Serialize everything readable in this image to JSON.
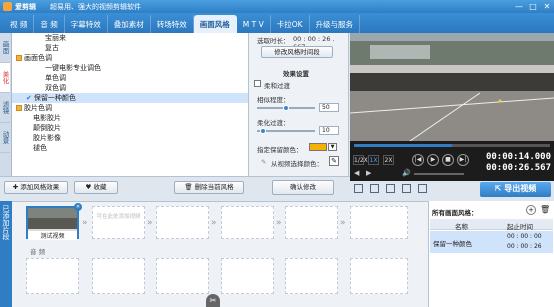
{
  "app": {
    "name": "爱剪辑",
    "slogan": "超易用、强大的视频剪辑软件"
  },
  "window": {
    "minimize": "—",
    "restore": "□",
    "close": "✕"
  },
  "tabs": [
    {
      "label": "视 频"
    },
    {
      "label": "音 频"
    },
    {
      "label": "字幕特效"
    },
    {
      "label": "叠加素材"
    },
    {
      "label": "转场特效"
    },
    {
      "label": "画面风格",
      "active": true
    },
    {
      "label": "M T V"
    },
    {
      "label": "卡拉OK"
    },
    {
      "label": "升级与服务"
    }
  ],
  "side_tabs": [
    {
      "label": "画面"
    },
    {
      "label": "美化",
      "active": true
    },
    {
      "label": "滤镜"
    },
    {
      "label": "动景"
    }
  ],
  "tree": [
    {
      "label": "宝丽来",
      "type": "deep"
    },
    {
      "label": "复古",
      "type": "deep"
    },
    {
      "label": "画面色调",
      "type": "group"
    },
    {
      "label": "一键电影专业调色",
      "type": "deep"
    },
    {
      "label": "单色调",
      "type": "deep"
    },
    {
      "label": "双色调",
      "type": "deep"
    },
    {
      "label": "保留一种颜色",
      "type": "deep",
      "selected": true
    },
    {
      "label": "胶片色调",
      "type": "group"
    },
    {
      "label": "电影胶片",
      "type": "child"
    },
    {
      "label": "颠倒胶片",
      "type": "child"
    },
    {
      "label": "胶片影像",
      "type": "child"
    },
    {
      "label": "褪色",
      "type": "child"
    }
  ],
  "settings": {
    "time_label": "选取时长：",
    "time_value": "00 : 00 : 26 . 667",
    "modify_time_button": "修改风格时间段",
    "section_title": "效果设置",
    "smooth_label": "柔和过渡",
    "similarity_label": "相似程度：",
    "similarity_value": "50",
    "similarity_level": 0.5,
    "softness_label": "柔化过渡：",
    "softness_value": "10",
    "softness_level": 0.1,
    "color_label": "指定保留颜色：",
    "pick_label": "从视频选择颜色："
  },
  "actions": {
    "add_style": "添加风格效果",
    "favorite": "收藏",
    "delete_style": "删除当前风格",
    "confirm": "确认修改"
  },
  "player": {
    "speeds": [
      "1/2X",
      "1X",
      "2X"
    ],
    "time_current": "00:00:14.000",
    "time_total": "00:00:26.567",
    "progress": 0.5
  },
  "export_button": "导出视频",
  "timeline": {
    "label": "已添加片段",
    "clip_name": "测试视频",
    "placeholder": "可在此处添加视频",
    "audio_label": "音 频"
  },
  "right_panel": {
    "title": "所有画面风格：",
    "col_name": "名称",
    "col_time": "起止时间",
    "row_name": "保留一种颜色",
    "row_start": "00 : 00 : 00",
    "row_end": "00 : 00 : 26"
  },
  "colors": {
    "accent": "#2f7ec4",
    "export": "#3d8fdc",
    "retain_color": "#f5b000"
  }
}
